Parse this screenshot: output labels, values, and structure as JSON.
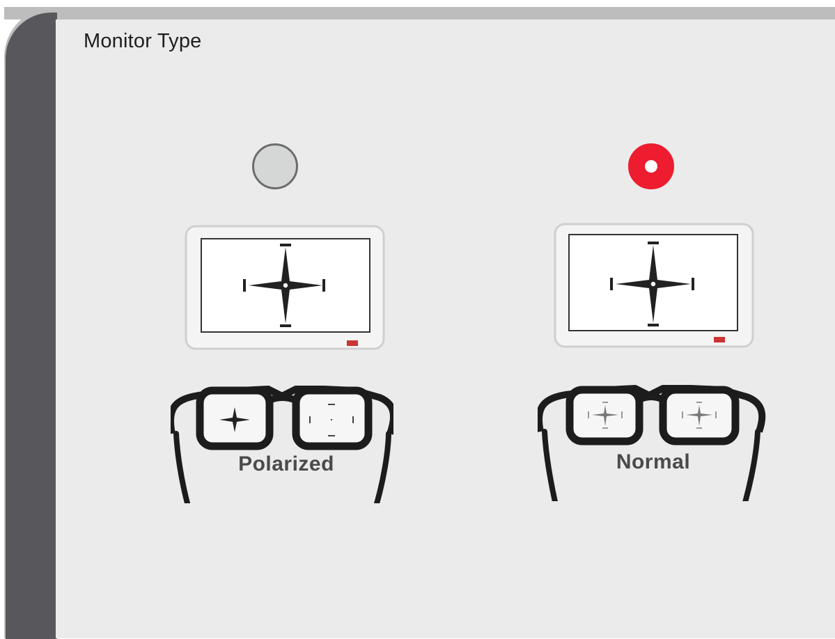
{
  "section": {
    "title": "Monitor Type"
  },
  "options": [
    {
      "label": "Polarized",
      "selected": false,
      "icon": "polarized-glasses-monitor-icon"
    },
    {
      "label": "Normal",
      "selected": true,
      "icon": "normal-glasses-monitor-icon"
    }
  ],
  "colors": {
    "accent": "#ed1c2e",
    "sidebar": "#58585c",
    "panel": "#ebebeb",
    "radio_off": "#d5d6d6"
  }
}
